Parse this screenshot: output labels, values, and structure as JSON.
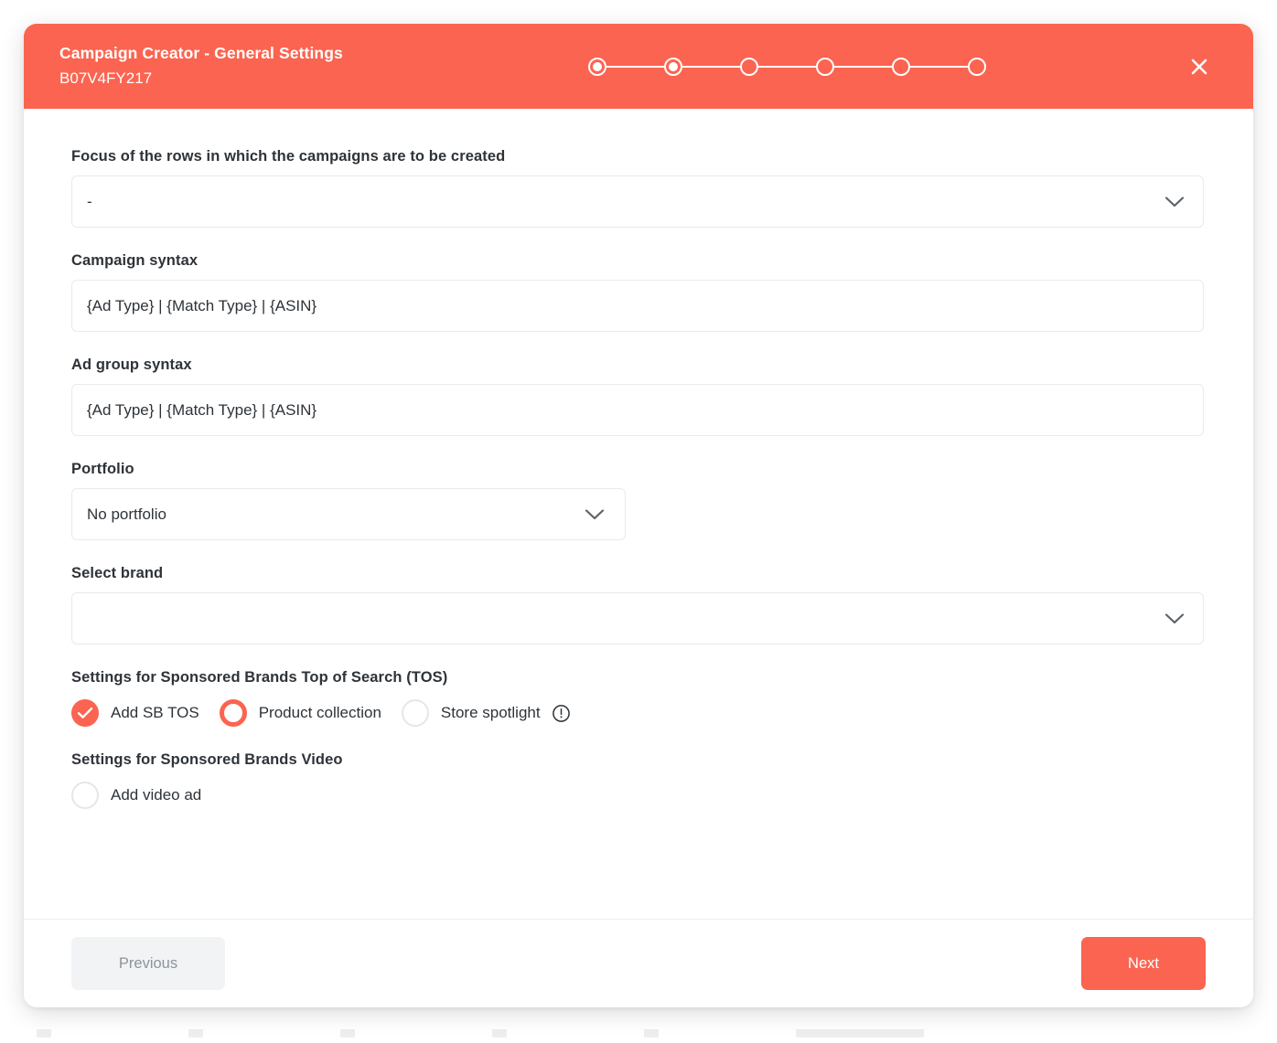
{
  "theme": {
    "accent": "#FB6450",
    "text": "#2e3338",
    "muted_text": "#8d949b",
    "border": "#e8eaec",
    "radio_off": "#e4e7ea",
    "footer_bg": "#f1f3f5"
  },
  "header": {
    "title": "Campaign Creator - General Settings",
    "subtitle": "B07V4FY217",
    "close_icon": "close-icon",
    "stepper": {
      "total_steps": 6,
      "completed_steps": 2,
      "steps": [
        {
          "index": 1,
          "state": "filled"
        },
        {
          "index": 2,
          "state": "filled"
        },
        {
          "index": 3,
          "state": "empty"
        },
        {
          "index": 4,
          "state": "empty"
        },
        {
          "index": 5,
          "state": "empty"
        },
        {
          "index": 6,
          "state": "empty"
        }
      ]
    }
  },
  "form": {
    "focus": {
      "label": "Focus of the rows in which the campaigns are to be created",
      "value": "-",
      "icon": "chevron-down-icon"
    },
    "campaign_syntax": {
      "label": "Campaign syntax",
      "value": "{Ad Type} | {Match Type} | {ASIN}"
    },
    "ad_group_syntax": {
      "label": "Ad group syntax",
      "value": "{Ad Type} | {Match Type} | {ASIN}"
    },
    "portfolio": {
      "label": "Portfolio",
      "value": "No portfolio",
      "icon": "chevron-down-icon"
    },
    "select_brand": {
      "label": "Select brand",
      "value": "",
      "icon": "chevron-down-icon"
    },
    "tos_section": {
      "title": "Settings for Sponsored Brands Top of Search (TOS)",
      "options": [
        {
          "label": "Add SB TOS",
          "state": "checked",
          "control": "checkbox"
        },
        {
          "label": "Product collection",
          "state": "selected",
          "control": "radio"
        },
        {
          "label": "Store spotlight",
          "state": "unselected",
          "control": "radio",
          "info_icon": "alert-circle-icon"
        }
      ]
    },
    "video_section": {
      "title": "Settings for Sponsored Brands Video",
      "options": [
        {
          "label": "Add video ad",
          "state": "unselected",
          "control": "radio"
        }
      ]
    }
  },
  "footer": {
    "previous_label": "Previous",
    "next_label": "Next"
  }
}
